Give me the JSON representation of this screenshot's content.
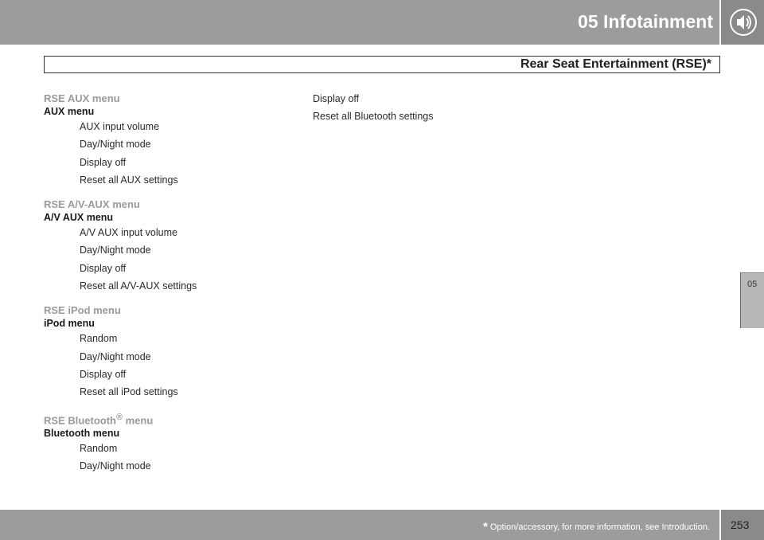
{
  "header": {
    "chapter_title": "05  Infotainment",
    "section_title": "Rear Seat Entertainment (RSE)*"
  },
  "icons": {
    "header": "speaker-icon"
  },
  "colors": {
    "header_bar": "#9c9c9c",
    "menu_title": "#9a9a9a",
    "tab": "#b8b8b8"
  },
  "column1": [
    {
      "title": "RSE AUX menu",
      "title_sup": "",
      "title_suffix": "",
      "subtitle": "AUX menu",
      "items": [
        "AUX input volume",
        "Day/Night mode",
        "Display off",
        "Reset all AUX settings"
      ]
    },
    {
      "title": "RSE A/V-AUX menu",
      "title_sup": "",
      "title_suffix": "",
      "subtitle": "A/V AUX menu",
      "items": [
        "A/V AUX input volume",
        "Day/Night mode",
        "Display off",
        "Reset all A/V-AUX settings"
      ]
    },
    {
      "title": "RSE iPod menu",
      "title_sup": "",
      "title_suffix": "",
      "subtitle": "iPod menu",
      "items": [
        "Random",
        "Day/Night mode",
        "Display off",
        "Reset all iPod settings"
      ]
    },
    {
      "title": "RSE Bluetooth",
      "title_sup": "®",
      "title_suffix": " menu",
      "subtitle": "Bluetooth menu",
      "items": [
        "Random",
        "Day/Night mode"
      ]
    }
  ],
  "column2": {
    "items": [
      "Display off",
      "Reset all Bluetooth settings"
    ]
  },
  "side_tab": {
    "label": "05"
  },
  "footer": {
    "star": "*",
    "note": " Option/accessory, for more information, see Introduction.",
    "page_number": "253"
  }
}
